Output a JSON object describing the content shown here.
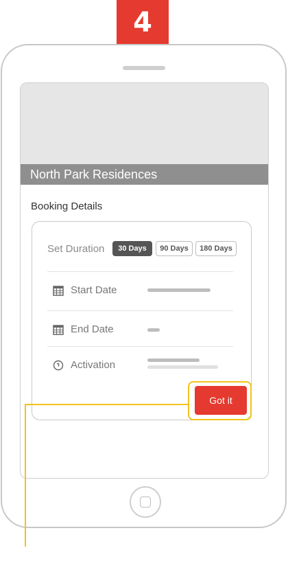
{
  "step": {
    "number": "4"
  },
  "header": {
    "property_name": "North Park Residences"
  },
  "booking": {
    "heading": "Booking Details",
    "duration": {
      "label": "Set Duration",
      "options": [
        "30 Days",
        "90 Days",
        "180 Days"
      ],
      "selected": "30 Days"
    },
    "rows": {
      "start_date": {
        "label": "Start Date",
        "icon": "calendar-icon"
      },
      "end_date": {
        "label": "End Date",
        "icon": "calendar-icon"
      },
      "activation": {
        "label": "Activation",
        "icon": "clock-icon"
      }
    },
    "confirm_label": "Got it"
  },
  "colors": {
    "accent": "#e53a2f",
    "highlight": "#f2c318",
    "title_bar": "#8f8f8f"
  }
}
